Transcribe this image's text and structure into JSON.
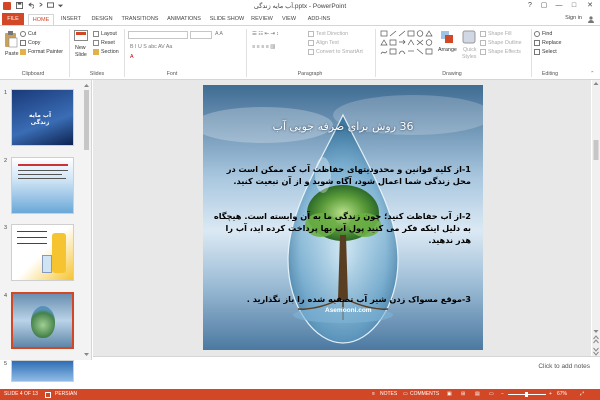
{
  "window": {
    "title": "آب مایه زندگی.pptx - PowerPoint",
    "controls": {
      "help": "?",
      "restore": "▢",
      "minimize": "—",
      "maximize": "□",
      "close": "✕"
    }
  },
  "tabs": [
    "FILE",
    "HOME",
    "INSERT",
    "DESIGN",
    "TRANSITIONS",
    "ANIMATIONS",
    "SLIDE SHOW",
    "REVIEW",
    "VIEW",
    "ADD-INS"
  ],
  "active_tab": "HOME",
  "signin": "Sign in",
  "ribbon": {
    "clipboard": {
      "label": "Clipboard",
      "paste": "Paste",
      "cut": "Cut",
      "copy": "Copy",
      "format_painter": "Format Painter"
    },
    "slides": {
      "label": "Slides",
      "new_slide": "New",
      "new_slide_2": "Slide",
      "layout": "Layout",
      "reset": "Reset",
      "section": "Section"
    },
    "font": {
      "label": "Font"
    },
    "paragraph": {
      "label": "Paragraph",
      "text_direction": "Text Direction",
      "align_text": "Align Text",
      "convert_smartart": "Convert to SmartArt"
    },
    "drawing": {
      "label": "Drawing",
      "arrange": "Arrange",
      "quick_styles": "Quick",
      "quick_styles_2": "Styles",
      "shape_fill": "Shape Fill",
      "shape_outline": "Shape Outline",
      "shape_effects": "Shape Effects"
    },
    "editing": {
      "label": "Editing",
      "find": "Find",
      "replace": "Replace",
      "select": "Select"
    }
  },
  "thumbnails": [
    {
      "num": "1",
      "title": "آب مایه زندگی"
    },
    {
      "num": "2"
    },
    {
      "num": "3"
    },
    {
      "num": "4"
    },
    {
      "num": "5"
    }
  ],
  "slide": {
    "title": "36 روش برای صرفه جویی آب",
    "para1": "1-از کلیه قوانین و محدودیتهای حفاظت آب که ممکن است در محل زندگی شما اعمال شود، آگاه شوید و از آن تبعیت کنید.",
    "para2": "2-از آب حفاظت کنید؛ چون زندگی ما به آن وابسته است. هیچگاه به دلیل اینکه فکر می کنید پول آب بها پرداخت کرده اید، آب را هدر ندهید.",
    "para3": "3-موقع مسواک زدن شیر آب تصفیه شده را باز نگذارید .",
    "watermark": "Asemooni.com"
  },
  "notes_placeholder": "Click to add notes",
  "status": {
    "slide_info": "SLIDE 4 OF 13",
    "language": "PERSIAN",
    "notes": "NOTES",
    "comments": "COMMENTS",
    "zoom": "67%"
  },
  "colors": {
    "accent": "#d24726"
  }
}
